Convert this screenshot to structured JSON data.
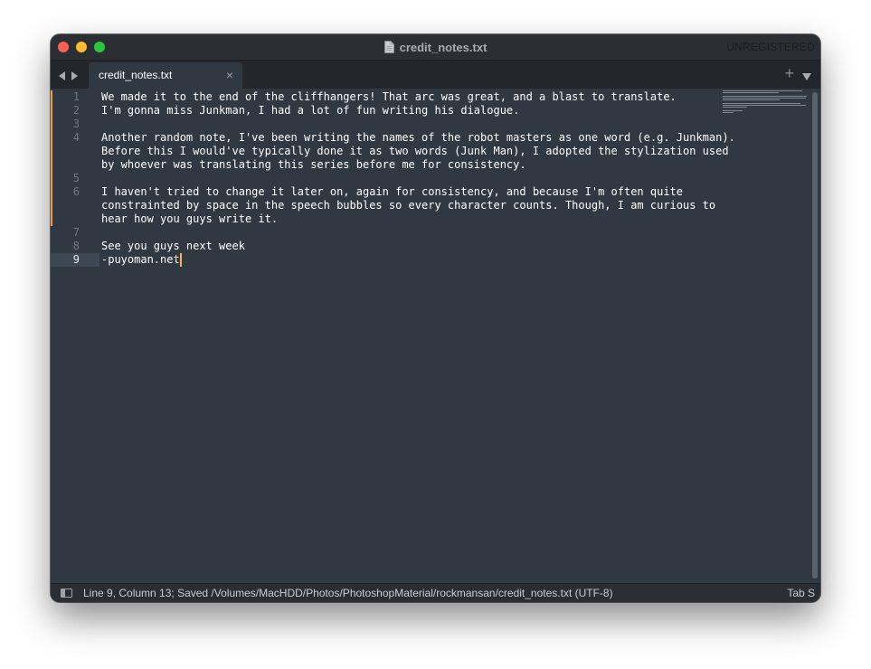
{
  "window": {
    "title": "credit_notes.txt",
    "registration_status": "UNREGISTERED"
  },
  "tabs": [
    {
      "label": "credit_notes.txt",
      "active": true
    }
  ],
  "editor": {
    "current_line": 9,
    "gutter": [
      "1",
      "2",
      "",
      "3",
      "4",
      "",
      "",
      "5",
      "6",
      "",
      "",
      "7",
      "8",
      "9"
    ],
    "lines": [
      "We made it to the end of the cliffhangers! That arc was great, and a blast to translate.",
      "I'm gonna miss Junkman, I had a lot of fun writing his dialogue.",
      "",
      "Another random note, I've been writing the names of the robot masters as one word (e.g. Junkman).",
      "Before this I would've typically done it as two words (Junk Man), I adopted the stylization used",
      "by whoever was translating this series before me for consistency.",
      "",
      "I haven't tried to change it later on, again for consistency, and because I'm often quite",
      "constrainted by space in the speech bubbles so every character counts. Though, I am curious to",
      "hear how you guys write it.",
      "",
      "See you guys next week",
      "-puyoman.net"
    ]
  },
  "statusbar": {
    "text": "Line 9, Column 13; Saved /Volumes/MacHDD/Photos/PhotoshopMaterial/rockmansan/credit_notes.txt (UTF-8)",
    "right": "Tab S"
  },
  "colors": {
    "background": "#303841",
    "text": "#ffffff",
    "modified_marker": "#e99d4c",
    "cursor": "#f9ae58"
  },
  "icons": [
    "close-button",
    "minimize-button",
    "maximize-button",
    "document-icon",
    "nav-back-icon",
    "nav-forward-icon",
    "close-icon",
    "plus-icon",
    "chevron-down-icon",
    "panel-toggle-icon"
  ]
}
